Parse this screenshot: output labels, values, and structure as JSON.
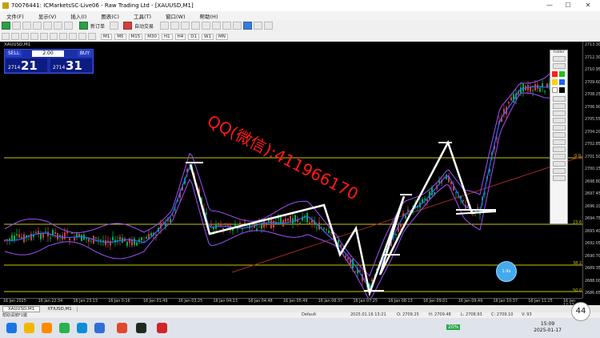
{
  "window": {
    "title": "70076441: ICMarketsSC-Live06 - Raw Trading Ltd - [XAUUSD,M1]",
    "minimize": "—",
    "maximize": "☐",
    "close": "✕"
  },
  "menu": [
    "文件(F)",
    "显示(V)",
    "插入(I)",
    "图表(C)",
    "工具(T)",
    "窗口(W)",
    "帮助(H)"
  ],
  "toolbar": {
    "new_order": "新订单",
    "auto_trading": "自动交易",
    "timeframes": [
      "M1",
      "M5",
      "M15",
      "M30",
      "H1",
      "H4",
      "D1",
      "W1",
      "MN"
    ]
  },
  "symbol_label": "XAUUSD,M1",
  "trade_panel": {
    "sell_label": "SELL",
    "buy_label": "BUY",
    "lot": "2.00",
    "sell_base": "2714",
    "sell_big": "21",
    "buy_base": "2714",
    "buy_big": "31"
  },
  "price_axis": [
    "2713.30",
    "2712.30",
    "2710.95",
    "2709.60",
    "2708.25",
    "2706.90",
    "2705.55",
    "2704.20",
    "2702.85",
    "2701.50",
    "2700.15",
    "2698.80",
    "2697.45",
    "2696.10",
    "2694.75",
    "2693.40",
    "2692.05",
    "2690.70",
    "2689.35",
    "2688.00",
    "2686.65"
  ],
  "fib_levels": [
    "0.0",
    "23.6",
    "38.2",
    "50.0"
  ],
  "time_axis": [
    "16 Jan 2025",
    "16 Jan 22:34",
    "16 Jan 23:13",
    "16 Jan 0:16",
    "16 Jan 01:49",
    "16 Jan 03:25",
    "16 Jan 04:13",
    "16 Jan 04:48",
    "16 Jan 05:49",
    "16 Jan 06:37",
    "16 Jan 07:25",
    "16 Jan 08:13",
    "16 Jan 09:01",
    "16 Jan 09:49",
    "16 Jan 10:37",
    "16 Jan 11:25",
    "16 Jan 12:13"
  ],
  "tabs": [
    "XAUUSD,M1",
    "XTIUSD,M1"
  ],
  "status": {
    "left": "帮助请按F1键",
    "profile": "Default",
    "datetime": "2025.01.16 13:21",
    "o": "O: 2709.25",
    "h": "H: 2709.48",
    "l": "L: 2708.93",
    "c": "C: 2709.10",
    "v": "V: 93"
  },
  "watermark": "QQ(微信):411966170",
  "badge": "44",
  "circle_btn": "1.9x",
  "taskbar": {
    "time": "15:09",
    "date": "2025-01-17",
    "percent": "20%"
  },
  "tools_panel": {
    "header": "Folder"
  },
  "colors": {
    "fib_line": "#c8c800",
    "candle_up": "#00b050",
    "candle_down": "#d04040",
    "envelope": "#a050ff",
    "ma_blue": "#2f6bff",
    "zigzag": "#ffffff",
    "trendline": "#a02828",
    "watermark": "#ff1a1a"
  }
}
